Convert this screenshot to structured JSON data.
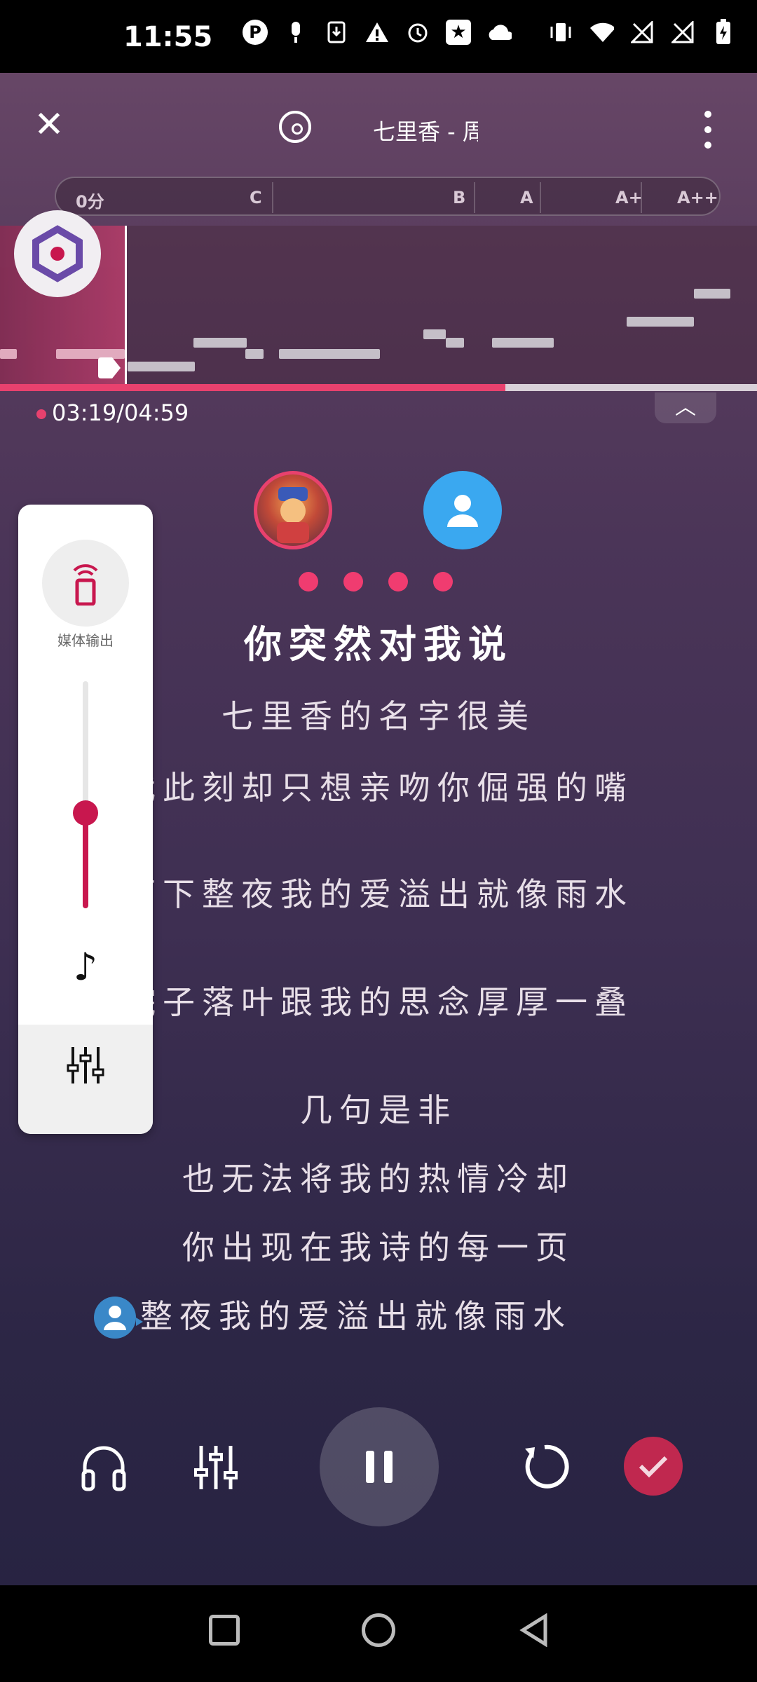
{
  "status_bar": {
    "time": "11:55",
    "icons": [
      "p-icon",
      "mic-icon",
      "download-icon",
      "warning-icon",
      "alarm-icon",
      "star-icon",
      "cloud-icon",
      "vibrate-icon",
      "wifi-icon",
      "signal-icon",
      "signal2-icon",
      "battery-charging-icon"
    ]
  },
  "header": {
    "close_label": "✕",
    "song_title": "七里香 - 周"
  },
  "score": {
    "current": "0分",
    "grades": [
      "C",
      "B",
      "A",
      "A+",
      "A++"
    ]
  },
  "playback": {
    "timeline": "03:19/04:59",
    "progress_fraction": 0.668
  },
  "lyrics": {
    "current": "你突然对我说",
    "lines": [
      "七里香的名字很美",
      "我此刻却只想亲吻你倔强的嘴",
      "雨下整夜我的爱溢出就像雨水",
      "院子落叶跟我的思念厚厚一叠",
      "几句是非",
      "也无法将我的热情冷却",
      "你出现在我诗的每一页",
      "整夜我的爱溢出就像雨水"
    ]
  },
  "side_panel": {
    "media_output_label": "媒体输出",
    "volume_fraction": 0.42
  },
  "colors": {
    "accent": "#e8416e",
    "volume": "#c8174e",
    "avatar_blue": "#3aa8f0"
  }
}
